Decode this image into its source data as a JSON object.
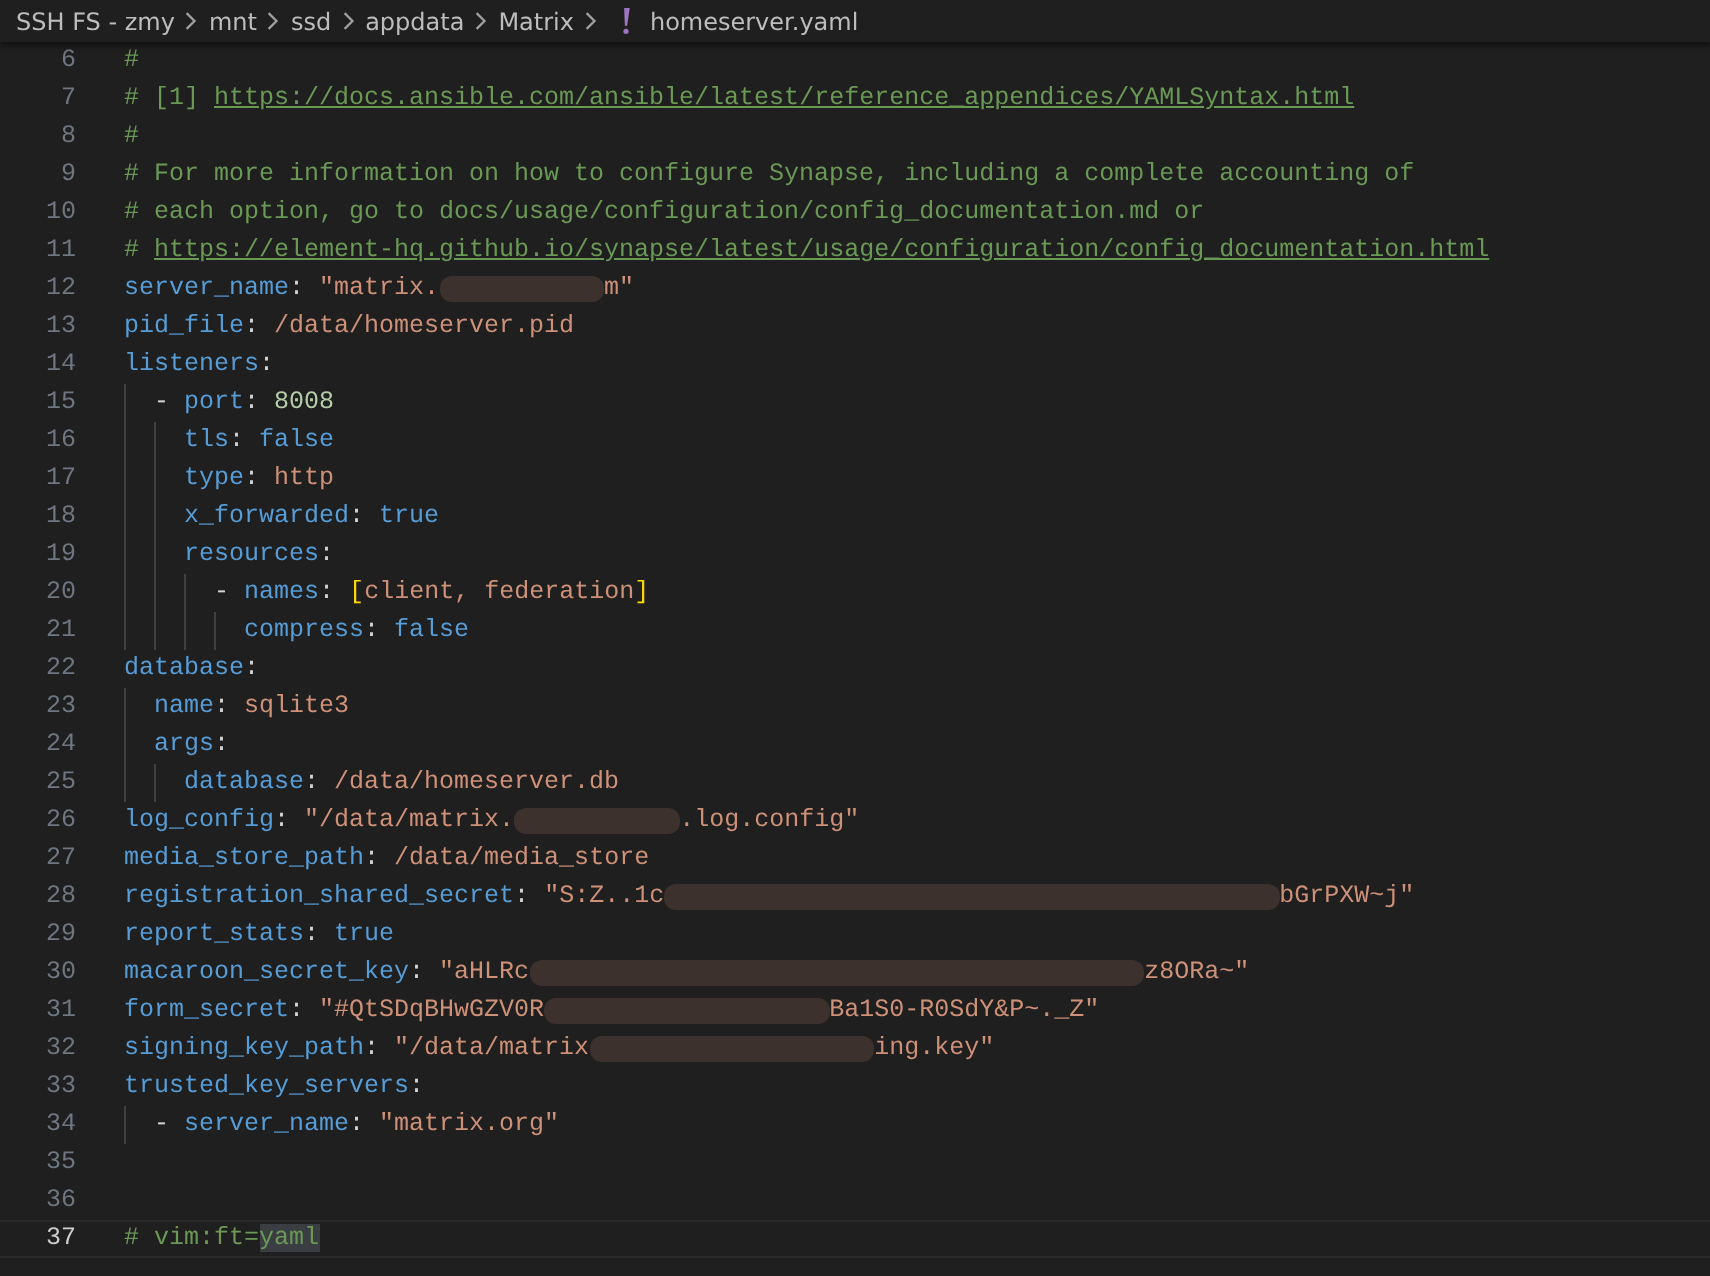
{
  "breadcrumb": [
    {
      "label": "SSH FS - zmy",
      "kind": "folder"
    },
    {
      "label": "mnt",
      "kind": "folder"
    },
    {
      "label": "ssd",
      "kind": "folder"
    },
    {
      "label": "appdata",
      "kind": "folder"
    },
    {
      "label": "Matrix",
      "kind": "folder"
    },
    {
      "label": "homeserver.yaml",
      "kind": "yaml-file"
    }
  ],
  "lines": [
    {
      "number": "6",
      "current": false,
      "tokens": [
        {
          "kind": "comment",
          "text": "#"
        }
      ]
    },
    {
      "number": "7",
      "current": false,
      "tokens": [
        {
          "kind": "comment",
          "text": "# [1] "
        },
        {
          "kind": "link",
          "text": "https://docs.ansible.com/ansible/latest/reference_appendices/YAMLSyntax.html"
        }
      ]
    },
    {
      "number": "8",
      "current": false,
      "tokens": [
        {
          "kind": "comment",
          "text": "#"
        }
      ]
    },
    {
      "number": "9",
      "current": false,
      "tokens": [
        {
          "kind": "comment",
          "text": "# For more information on how to configure Synapse, including a complete accounting of"
        }
      ]
    },
    {
      "number": "10",
      "current": false,
      "tokens": [
        {
          "kind": "comment",
          "text": "# each option, go to docs/usage/configuration/config_documentation.md or"
        }
      ]
    },
    {
      "number": "11",
      "current": false,
      "tokens": [
        {
          "kind": "comment",
          "text": "# "
        },
        {
          "kind": "link",
          "text": "https://element-hq.github.io/synapse/latest/usage/configuration/config_documentation.html"
        }
      ]
    },
    {
      "number": "12",
      "current": false,
      "tokens": [
        {
          "kind": "key",
          "text": "server_name"
        },
        {
          "kind": "punct",
          "text": ": "
        },
        {
          "kind": "string",
          "text": "\"matrix."
        },
        {
          "kind": "blot"
        },
        {
          "kind": "string",
          "text": "m\""
        }
      ]
    },
    {
      "number": "13",
      "current": false,
      "tokens": [
        {
          "kind": "key",
          "text": "pid_file"
        },
        {
          "kind": "punct",
          "text": ": "
        },
        {
          "kind": "string",
          "text": "/data/homeserver.pid"
        }
      ]
    },
    {
      "number": "14",
      "current": false,
      "tokens": [
        {
          "kind": "key",
          "text": "listeners"
        },
        {
          "kind": "punct",
          "text": ":"
        }
      ],
      "children": [
        {
          "number": "15",
          "current": false,
          "tokens": [
            {
              "kind": "punct",
              "text": "- "
            },
            {
              "kind": "key",
              "text": "port"
            },
            {
              "kind": "punct",
              "text": ": "
            },
            {
              "kind": "number",
              "text": "8008"
            }
          ],
          "children": [
            {
              "number": "16",
              "current": false,
              "tokens": [
                {
                  "kind": "key",
                  "text": "tls"
                },
                {
                  "kind": "punct",
                  "text": ": "
                },
                {
                  "kind": "bool",
                  "text": "false"
                }
              ]
            },
            {
              "number": "17",
              "current": false,
              "tokens": [
                {
                  "kind": "key",
                  "text": "type"
                },
                {
                  "kind": "punct",
                  "text": ": "
                },
                {
                  "kind": "string",
                  "text": "http"
                }
              ]
            },
            {
              "number": "18",
              "current": false,
              "tokens": [
                {
                  "kind": "key",
                  "text": "x_forwarded"
                },
                {
                  "kind": "punct",
                  "text": ": "
                },
                {
                  "kind": "bool",
                  "text": "true"
                }
              ]
            },
            {
              "number": "19",
              "current": false,
              "tokens": [
                {
                  "kind": "key",
                  "text": "resources"
                },
                {
                  "kind": "punct",
                  "text": ":"
                }
              ],
              "children": [
                {
                  "number": "20",
                  "current": false,
                  "tokens": [
                    {
                      "kind": "punct",
                      "text": "- "
                    },
                    {
                      "kind": "key",
                      "text": "names"
                    },
                    {
                      "kind": "punct",
                      "text": ": "
                    },
                    {
                      "kind": "bracket",
                      "text": "["
                    },
                    {
                      "kind": "string",
                      "text": "client, federation"
                    },
                    {
                      "kind": "bracket",
                      "text": "]"
                    }
                  ],
                  "children": [
                    {
                      "number": "21",
                      "current": false,
                      "tokens": [
                        {
                          "kind": "key",
                          "text": "compress"
                        },
                        {
                          "kind": "punct",
                          "text": ": "
                        },
                        {
                          "kind": "bool",
                          "text": "false"
                        }
                      ]
                    }
                  ]
                }
              ]
            }
          ]
        }
      ]
    },
    {
      "number": "22",
      "current": false,
      "tokens": [
        {
          "kind": "key",
          "text": "database"
        },
        {
          "kind": "punct",
          "text": ":"
        }
      ],
      "children": [
        {
          "number": "23",
          "current": false,
          "tokens": [
            {
              "kind": "key",
              "text": "name"
            },
            {
              "kind": "punct",
              "text": ": "
            },
            {
              "kind": "string",
              "text": "sqlite3"
            }
          ]
        },
        {
          "number": "24",
          "current": false,
          "tokens": [
            {
              "kind": "key",
              "text": "args"
            },
            {
              "kind": "punct",
              "text": ":"
            }
          ],
          "children": [
            {
              "number": "25",
              "current": false,
              "tokens": [
                {
                  "kind": "key",
                  "text": "database"
                },
                {
                  "kind": "punct",
                  "text": ": "
                },
                {
                  "kind": "string",
                  "text": "/data/homeserver.db"
                }
              ]
            }
          ]
        }
      ]
    },
    {
      "number": "26",
      "current": false,
      "tokens": [
        {
          "kind": "key",
          "text": "log_config"
        },
        {
          "kind": "punct",
          "text": ": "
        },
        {
          "kind": "string",
          "text": "\"/data/matrix."
        },
        {
          "kind": "blot"
        },
        {
          "kind": "string",
          "text": ".log.config\""
        }
      ]
    },
    {
      "number": "27",
      "current": false,
      "tokens": [
        {
          "kind": "key",
          "text": "media_store_path"
        },
        {
          "kind": "punct",
          "text": ": "
        },
        {
          "kind": "string",
          "text": "/data/media_store"
        }
      ]
    },
    {
      "number": "28",
      "current": false,
      "tokens": [
        {
          "kind": "key",
          "text": "registration_shared_secret"
        },
        {
          "kind": "punct",
          "text": ": "
        },
        {
          "kind": "string",
          "text": "\"S:Z..1c"
        },
        {
          "kind": "smear"
        },
        {
          "kind": "string",
          "text": "bGrPXW~j\""
        }
      ]
    },
    {
      "number": "29",
      "current": false,
      "tokens": [
        {
          "kind": "key",
          "text": "report_stats"
        },
        {
          "kind": "punct",
          "text": ": "
        },
        {
          "kind": "bool",
          "text": "true"
        }
      ]
    },
    {
      "number": "30",
      "current": false,
      "tokens": [
        {
          "kind": "key",
          "text": "macaroon_secret_key"
        },
        {
          "kind": "punct",
          "text": ": "
        },
        {
          "kind": "string",
          "text": "\"aHLRc"
        },
        {
          "kind": "smear"
        },
        {
          "kind": "string",
          "text": "z8ORa~\""
        }
      ]
    },
    {
      "number": "31",
      "current": false,
      "tokens": [
        {
          "kind": "key",
          "text": "form_secret"
        },
        {
          "kind": "punct",
          "text": ": "
        },
        {
          "kind": "string",
          "text": "\"#QtSDqBHwGZV0R"
        },
        {
          "kind": "streak"
        },
        {
          "kind": "string",
          "text": "Ba1S0-R0SdY&P~._Z\""
        }
      ]
    },
    {
      "number": "32",
      "current": false,
      "tokens": [
        {
          "kind": "key",
          "text": "signing_key_path"
        },
        {
          "kind": "punct",
          "text": ": "
        },
        {
          "kind": "string",
          "text": "\"/data/matrix"
        },
        {
          "kind": "streak"
        },
        {
          "kind": "string",
          "text": "ing.key\""
        }
      ]
    },
    {
      "number": "33",
      "current": false,
      "tokens": [
        {
          "kind": "key",
          "text": "trusted_key_servers"
        },
        {
          "kind": "punct",
          "text": ":"
        }
      ],
      "children": [
        {
          "number": "34",
          "current": false,
          "tokens": [
            {
              "kind": "punct",
              "text": "- "
            },
            {
              "kind": "key",
              "text": "server_name"
            },
            {
              "kind": "punct",
              "text": ": "
            },
            {
              "kind": "string",
              "text": "\"matrix.org\""
            }
          ]
        }
      ]
    },
    {
      "number": "35",
      "current": false
    },
    {
      "number": "36",
      "current": false
    },
    {
      "number": "37",
      "current": true,
      "tokens": [
        {
          "kind": "comment",
          "text": "# vim:ft="
        },
        {
          "kind": "match",
          "text": "yaml"
        }
      ]
    }
  ]
}
